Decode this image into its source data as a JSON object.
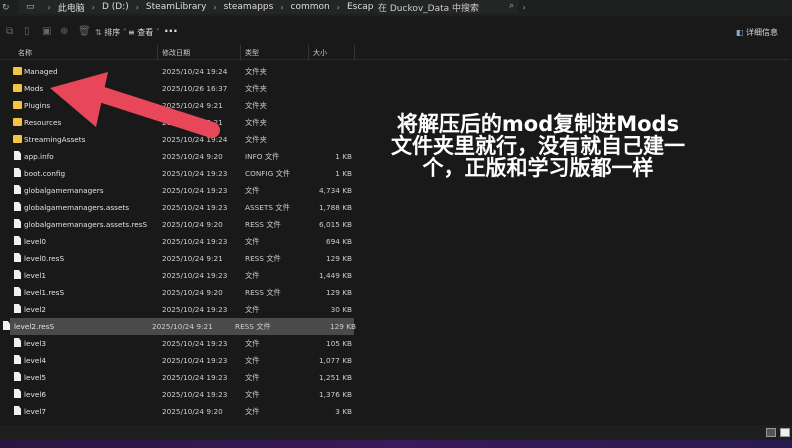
{
  "address_bar": {
    "breadcrumbs": [
      "此电脑",
      "D (D:)",
      "SteamLibrary",
      "steamapps",
      "common",
      "Escape from Duckov",
      "Duckov_Data"
    ],
    "search_placeholder": "在 Duckov_Data 中搜索"
  },
  "toolbar": {
    "sort_label": "排序",
    "view_label": "查看",
    "more_label": "···",
    "details_label": "详细信息"
  },
  "columns": {
    "name": "名称",
    "date": "修改日期",
    "type": "类型",
    "size": "大小"
  },
  "files": [
    {
      "name": "Managed",
      "date": "2025/10/24 19:24",
      "type": "文件夹",
      "size": "",
      "kind": "folder"
    },
    {
      "name": "Mods",
      "date": "2025/10/26 16:37",
      "type": "文件夹",
      "size": "",
      "kind": "folder"
    },
    {
      "name": "Plugins",
      "date": "2025/10/24 9:21",
      "type": "文件夹",
      "size": "",
      "kind": "folder"
    },
    {
      "name": "Resources",
      "date": "2025/10/24 9:21",
      "type": "文件夹",
      "size": "",
      "kind": "folder"
    },
    {
      "name": "StreamingAssets",
      "date": "2025/10/24 19:24",
      "type": "文件夹",
      "size": "",
      "kind": "folder"
    },
    {
      "name": "app.info",
      "date": "2025/10/24 9:20",
      "type": "INFO 文件",
      "size": "1 KB",
      "kind": "file"
    },
    {
      "name": "boot.config",
      "date": "2025/10/24 19:23",
      "type": "CONFIG 文件",
      "size": "1 KB",
      "kind": "file"
    },
    {
      "name": "globalgamemanagers",
      "date": "2025/10/24 19:23",
      "type": "文件",
      "size": "4,734 KB",
      "kind": "file"
    },
    {
      "name": "globalgamemanagers.assets",
      "date": "2025/10/24 19:23",
      "type": "ASSETS 文件",
      "size": "1,788 KB",
      "kind": "file"
    },
    {
      "name": "globalgamemanagers.assets.resS",
      "date": "2025/10/24 9:20",
      "type": "RESS 文件",
      "size": "6,015 KB",
      "kind": "file"
    },
    {
      "name": "level0",
      "date": "2025/10/24 19:23",
      "type": "文件",
      "size": "694 KB",
      "kind": "file"
    },
    {
      "name": "level0.resS",
      "date": "2025/10/24 9:21",
      "type": "RESS 文件",
      "size": "129 KB",
      "kind": "file"
    },
    {
      "name": "level1",
      "date": "2025/10/24 19:23",
      "type": "文件",
      "size": "1,449 KB",
      "kind": "file"
    },
    {
      "name": "level1.resS",
      "date": "2025/10/24 9:20",
      "type": "RESS 文件",
      "size": "129 KB",
      "kind": "file"
    },
    {
      "name": "level2",
      "date": "2025/10/24 19:23",
      "type": "文件",
      "size": "30 KB",
      "kind": "file"
    },
    {
      "name": "level2.resS",
      "date": "2025/10/24 9:21",
      "type": "RESS 文件",
      "size": "129 KB",
      "kind": "file",
      "selected": true
    },
    {
      "name": "level3",
      "date": "2025/10/24 19:23",
      "type": "文件",
      "size": "105 KB",
      "kind": "file"
    },
    {
      "name": "level4",
      "date": "2025/10/24 19:23",
      "type": "文件",
      "size": "1,077 KB",
      "kind": "file"
    },
    {
      "name": "level5",
      "date": "2025/10/24 19:23",
      "type": "文件",
      "size": "1,251 KB",
      "kind": "file"
    },
    {
      "name": "level6",
      "date": "2025/10/24 19:23",
      "type": "文件",
      "size": "1,376 KB",
      "kind": "file"
    },
    {
      "name": "level7",
      "date": "2025/10/24 9:20",
      "type": "文件",
      "size": "3 KB",
      "kind": "file"
    }
  ],
  "overlay": {
    "caption": "将解压后的mod复制进Mods文件夹里就行，没有就自己建一个，正版和学习版都一样",
    "arrow_color": "#e8475a"
  }
}
